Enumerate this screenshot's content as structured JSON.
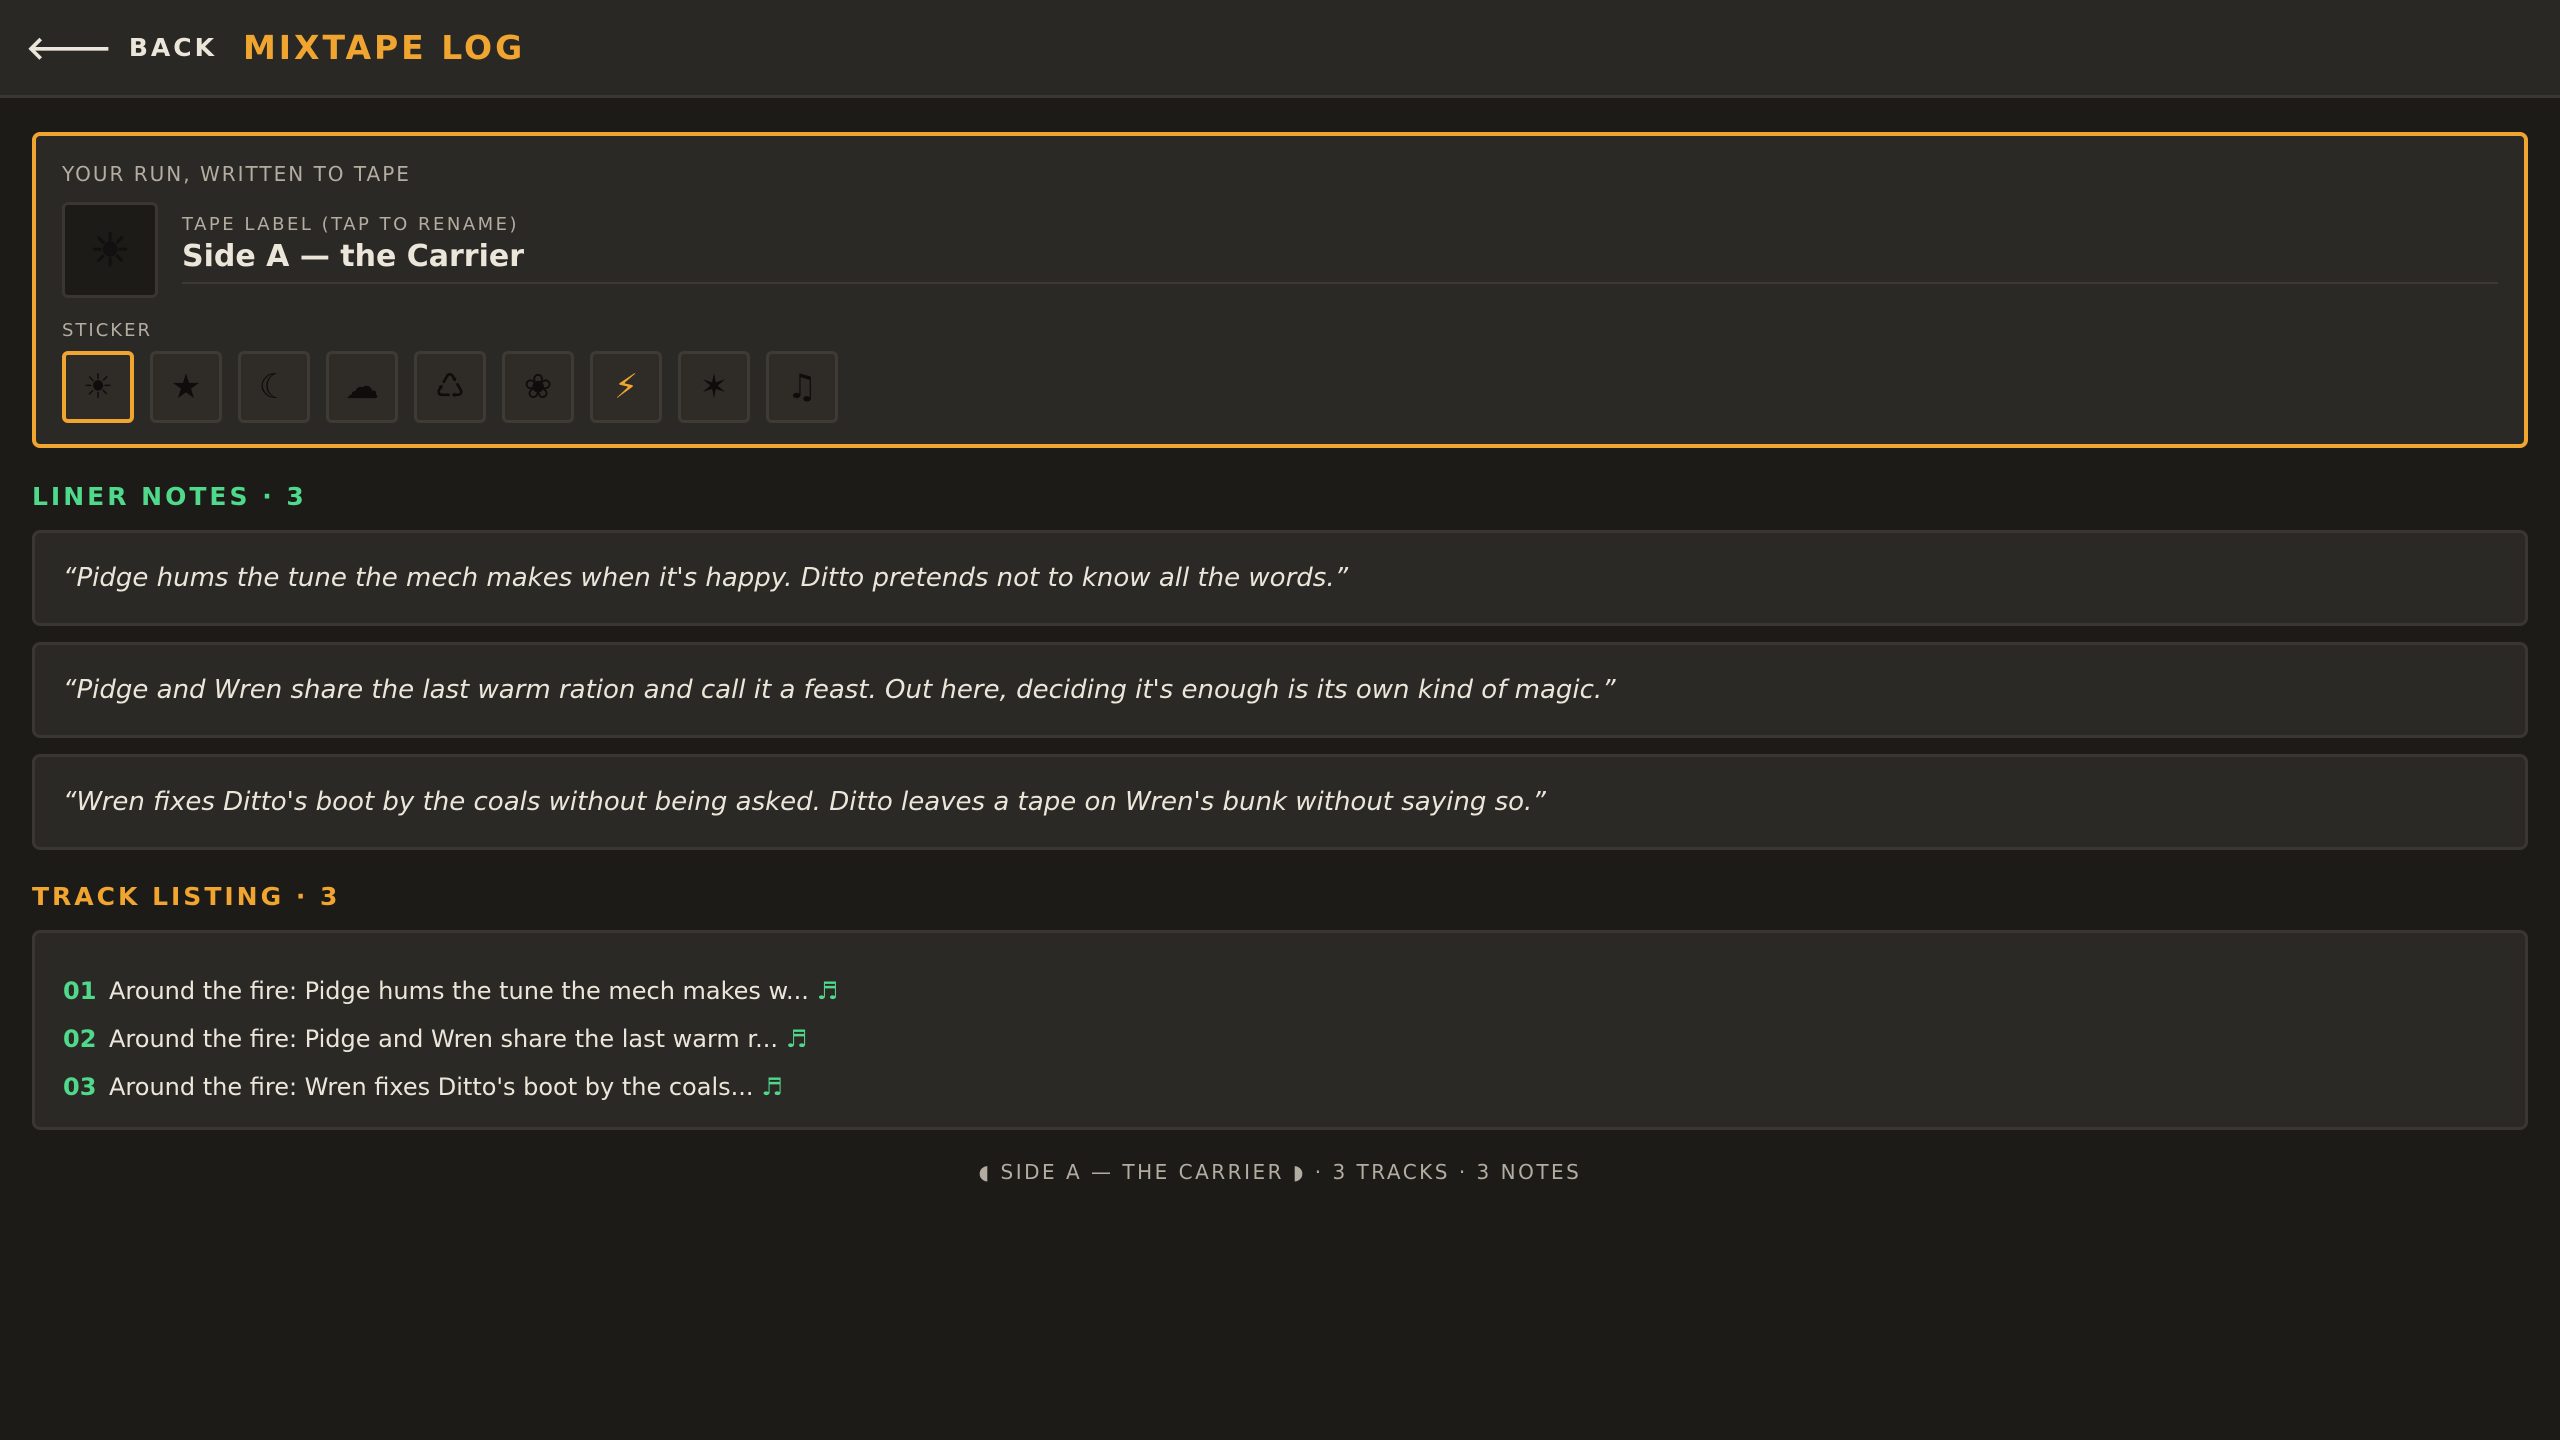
{
  "header": {
    "back_label": "BACK",
    "title": "MIXTAPE LOG"
  },
  "tape": {
    "heading": "YOUR RUN, WRITTEN TO TAPE",
    "preview_sticker": "☀",
    "label_caption": "TAPE LABEL (TAP TO RENAME)",
    "label_value": "Side A — the Carrier",
    "sticker_caption": "STICKER",
    "stickers": [
      {
        "glyph": "☀",
        "name": "sun"
      },
      {
        "glyph": "★",
        "name": "star"
      },
      {
        "glyph": "☾",
        "name": "moon"
      },
      {
        "glyph": "☁",
        "name": "cloud"
      },
      {
        "glyph": "♺",
        "name": "recycle"
      },
      {
        "glyph": "❀",
        "name": "flower"
      },
      {
        "glyph": "⚡",
        "name": "bolt"
      },
      {
        "glyph": "✶",
        "name": "sparkle"
      },
      {
        "glyph": "♫",
        "name": "music-note"
      }
    ],
    "selected_sticker": "sun"
  },
  "notes": {
    "heading": "LINER NOTES · 3",
    "items": [
      "“Pidge hums the tune the mech makes when it's happy. Ditto pretends not to know all the words.”",
      "“Pidge and Wren share the last warm ration and call it a feast. Out here, deciding it's enough is its own kind of magic.”",
      "“Wren fixes Ditto's boot by the coals without being asked. Ditto leaves a tape on Wren's bunk without saying so.”"
    ]
  },
  "tracks": {
    "heading": "TRACK LISTING · 3",
    "items": [
      {
        "num": "01",
        "text": "Around the fire: Pidge hums the tune the mech makes w...",
        "icon": "♬"
      },
      {
        "num": "02",
        "text": "Around the fire: Pidge and Wren share the last warm r...",
        "icon": "♬"
      },
      {
        "num": "03",
        "text": "Around the fire: Wren fixes Ditto's boot by the coals...",
        "icon": "♬"
      }
    ]
  },
  "footer": {
    "text": "◖ SIDE A — THE CARRIER ◗ · 3 TRACKS · 3 NOTES"
  },
  "colors": {
    "accent": "#f0a530",
    "green": "#4fd98b",
    "background": "#1c1b18",
    "panel": "#2b2925"
  }
}
